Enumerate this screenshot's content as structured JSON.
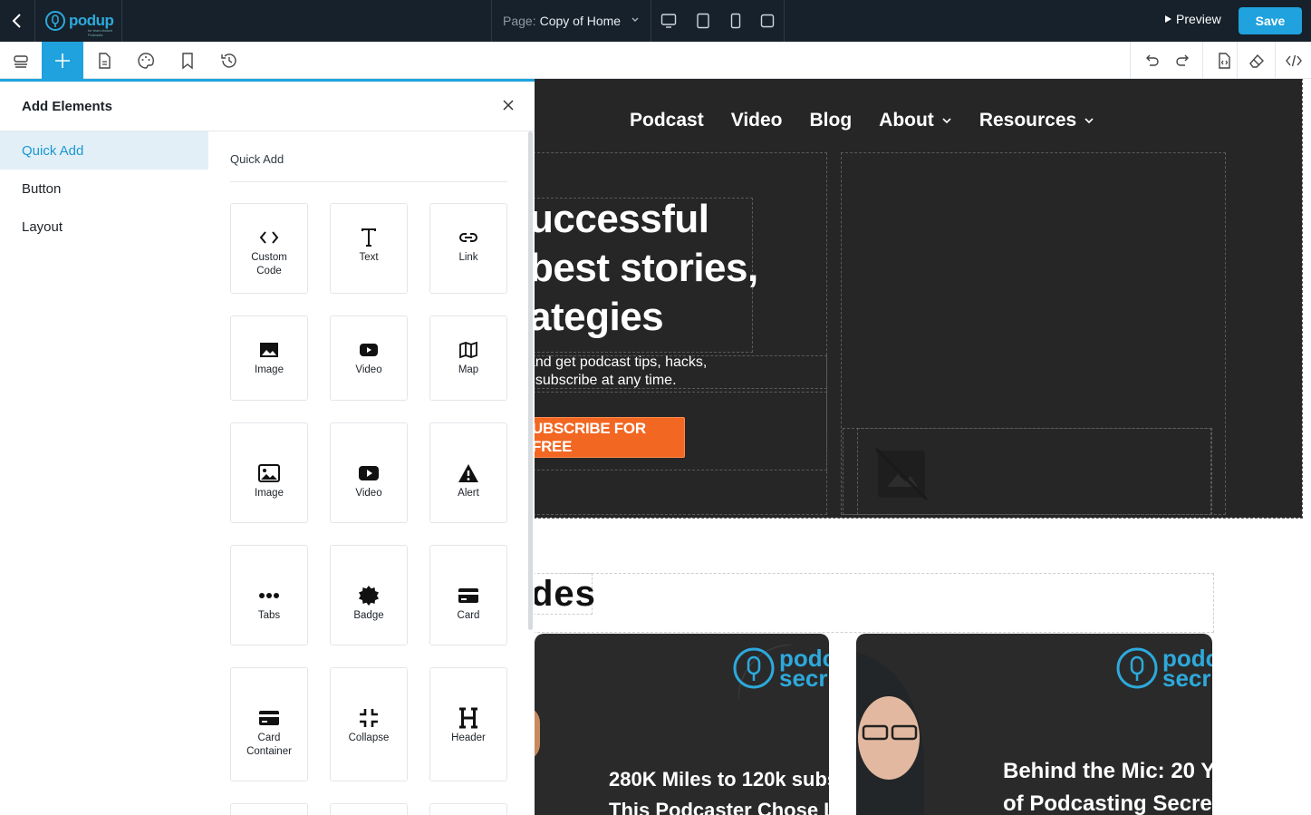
{
  "topbar": {
    "logo_text": "podup",
    "logo_sub": "for team-based Podcasts",
    "page_label": "Page:",
    "page_value": "Copy of Home",
    "preview_label": "Preview",
    "save_label": "Save"
  },
  "panel": {
    "title": "Add Elements",
    "categories": [
      {
        "label": "Quick Add"
      },
      {
        "label": "Button"
      },
      {
        "label": "Layout"
      }
    ],
    "grid_title": "Quick Add",
    "tiles": [
      {
        "label": "Custom Code",
        "icon": "code-icon"
      },
      {
        "label": "Text",
        "icon": "text-icon"
      },
      {
        "label": "Link",
        "icon": "link-icon"
      },
      {
        "label": "Image",
        "icon": "image-icon"
      },
      {
        "label": "Video",
        "icon": "video-icon"
      },
      {
        "label": "Map",
        "icon": "map-icon"
      },
      {
        "label": "Image",
        "icon": "image-icon"
      },
      {
        "label": "Video",
        "icon": "video-icon"
      },
      {
        "label": "Alert",
        "icon": "alert-icon"
      },
      {
        "label": "Tabs",
        "icon": "tabs-icon"
      },
      {
        "label": "Badge",
        "icon": "badge-icon"
      },
      {
        "label": "Card",
        "icon": "card-icon"
      },
      {
        "label": "Card Container",
        "icon": "card-container-icon"
      },
      {
        "label": "Collapse",
        "icon": "collapse-icon"
      },
      {
        "label": "Header",
        "icon": "header-icon"
      }
    ]
  },
  "canvas": {
    "nav": [
      {
        "label": "Podcast"
      },
      {
        "label": "Video"
      },
      {
        "label": "Blog"
      },
      {
        "label": "About"
      },
      {
        "label": "Resources"
      }
    ],
    "hero_lines": [
      "uccessful",
      "best stories,",
      "ategies"
    ],
    "hero_text_lines": [
      " and get podcast tips, hacks,",
      "nsubscribe at any time."
    ],
    "subscribe_label": "UBSCRIBE FOR FREE",
    "section_heading": "des",
    "cards": [
      {
        "brand": "podc",
        "brand2": "secr",
        "title_lines": [
          "280K Miles to 120k subs",
          "This Podcaster Chose L"
        ]
      },
      {
        "brand": "podc",
        "brand2": "secr",
        "title_lines": [
          "Behind the Mic: 20 Y",
          "of Podcasting Secre"
        ]
      }
    ]
  },
  "colors": {
    "accent": "#1fa2dd",
    "topbar": "#16212b",
    "hero_bg": "#262626",
    "cta": "#f26722"
  }
}
